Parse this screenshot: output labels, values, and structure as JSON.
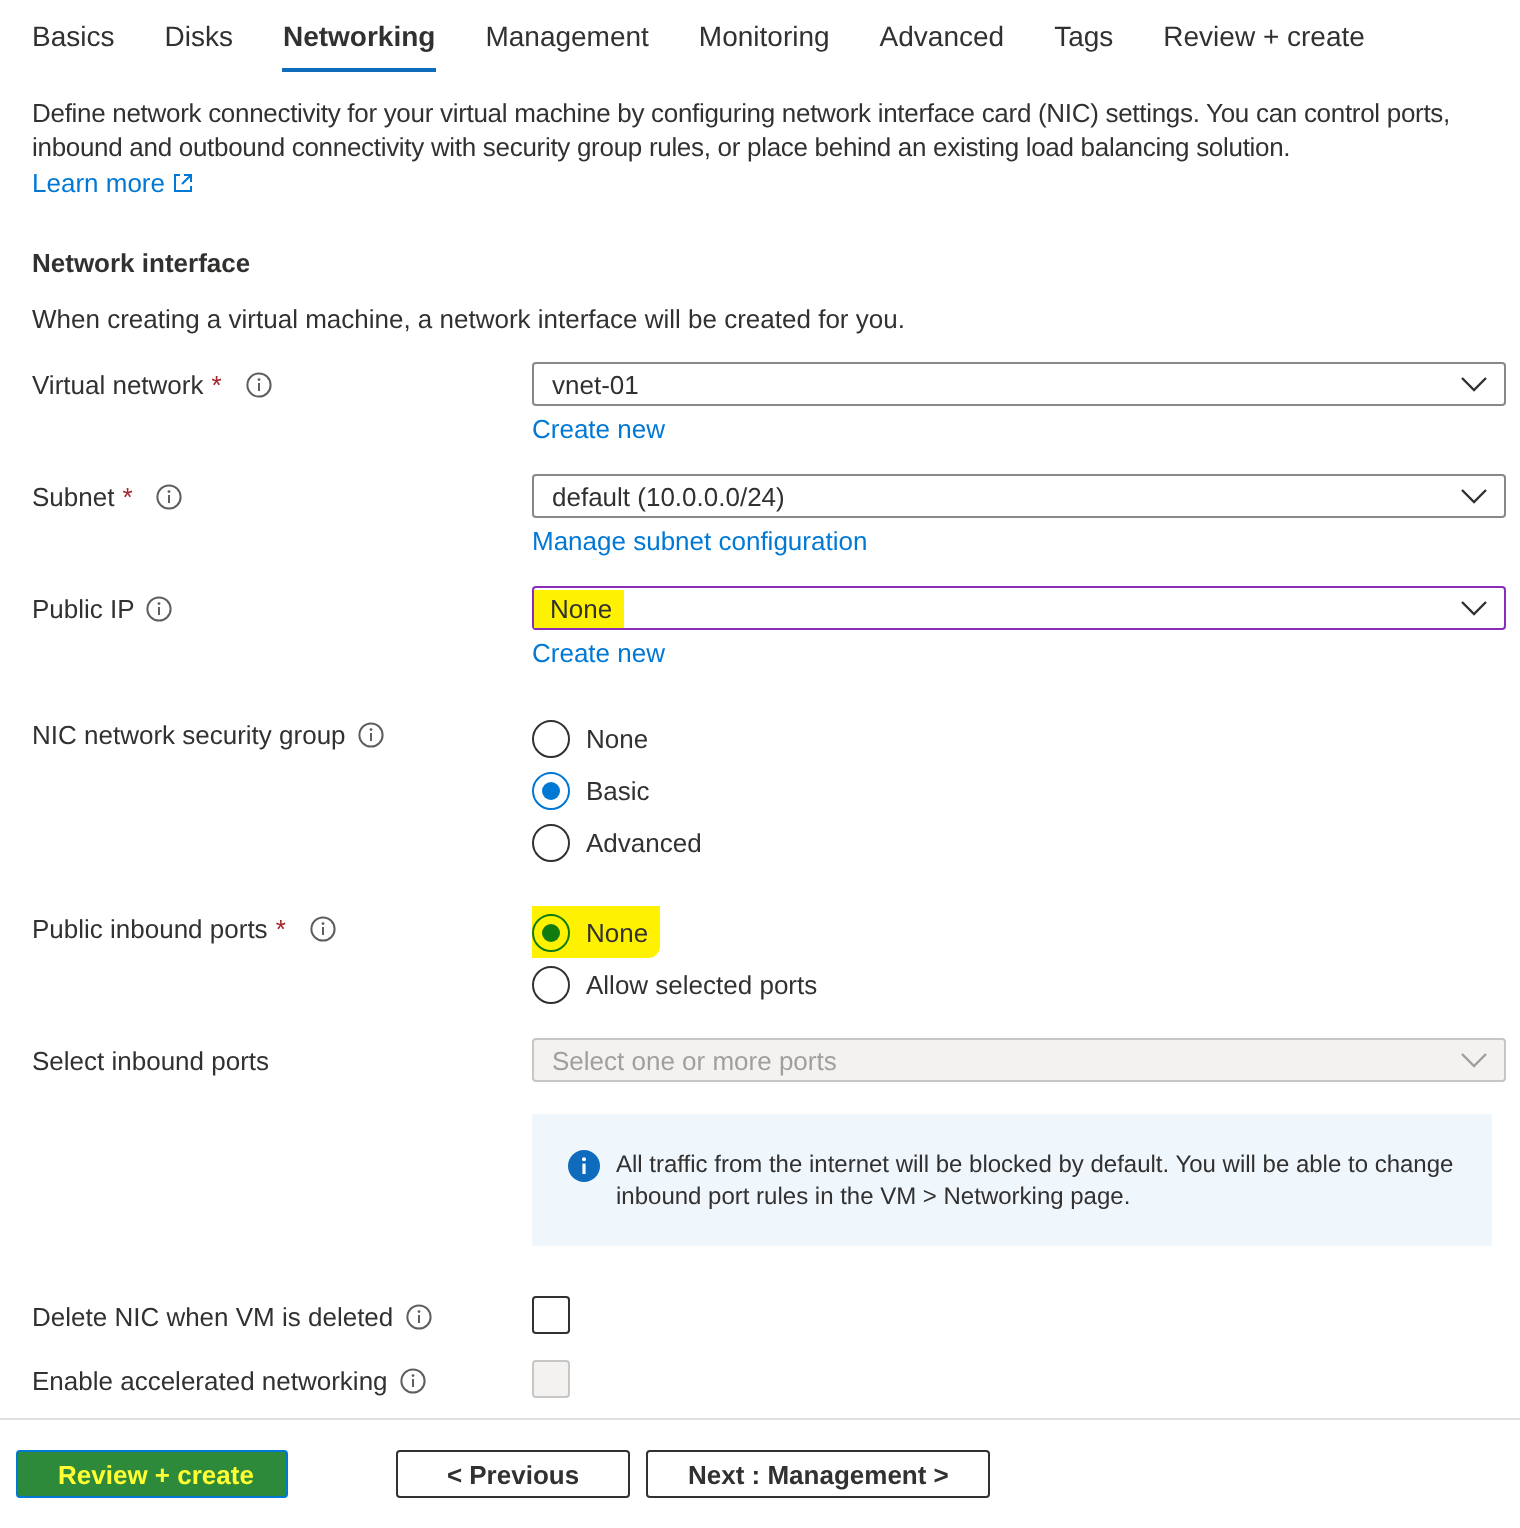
{
  "tabs": [
    {
      "label": "Basics",
      "selected": false
    },
    {
      "label": "Disks",
      "selected": false
    },
    {
      "label": "Networking",
      "selected": true
    },
    {
      "label": "Management",
      "selected": false
    },
    {
      "label": "Monitoring",
      "selected": false
    },
    {
      "label": "Advanced",
      "selected": false
    },
    {
      "label": "Tags",
      "selected": false
    },
    {
      "label": "Review + create",
      "selected": false
    }
  ],
  "description": {
    "text": "Define network connectivity for your virtual machine by configuring network interface card (NIC) settings. You can control ports, inbound and outbound connectivity with security group rules, or place behind an existing load balancing solution.",
    "link": "Learn more"
  },
  "section": {
    "title": "Network interface",
    "subtitle": "When creating a virtual machine, a network interface will be created for you."
  },
  "fields": [
    {
      "kind": "dropdown",
      "label": "Virtual network",
      "required_mark": "*",
      "info": true,
      "value": "vnet-01",
      "link": "Create new"
    },
    {
      "kind": "dropdown",
      "label": "Subnet",
      "required_mark": "*",
      "info": true,
      "value": "default (10.0.0.0/24)",
      "link": "Manage subnet configuration"
    },
    {
      "kind": "dropdown",
      "label": "Public IP",
      "info": true,
      "value": "None",
      "link": "Create new",
      "focused": true,
      "highlighted": true
    },
    {
      "kind": "radio",
      "label": "NIC network security group",
      "info": true,
      "options": [
        {
          "label": "None",
          "selected": false
        },
        {
          "label": "Basic",
          "selected": true
        },
        {
          "label": "Advanced",
          "selected": false
        }
      ]
    },
    {
      "kind": "radio",
      "label": "Public inbound ports",
      "required_mark": "*",
      "info": true,
      "options": [
        {
          "label": "None",
          "selected": true,
          "highlighted": true
        },
        {
          "label": "Allow selected ports",
          "selected": false
        }
      ]
    },
    {
      "kind": "dropdown",
      "label": "Select inbound ports",
      "disabled": true,
      "placeholder": "Select one or more ports",
      "note": "All traffic from the internet will be blocked by default. You will be able to change inbound port rules in the VM > Networking page."
    },
    {
      "kind": "checkbox",
      "label": "Delete NIC when VM is deleted",
      "info": true,
      "checked": false
    },
    {
      "kind": "checkbox",
      "label": "Enable accelerated networking",
      "info": true,
      "checked": false,
      "disabled": true
    }
  ],
  "buttons": [
    {
      "label": "Review + create",
      "kind": "primary",
      "highlighted": true
    },
    {
      "label": "< Previous",
      "kind": "secondary"
    },
    {
      "label": "Next : Management >",
      "kind": "secondary"
    }
  ]
}
